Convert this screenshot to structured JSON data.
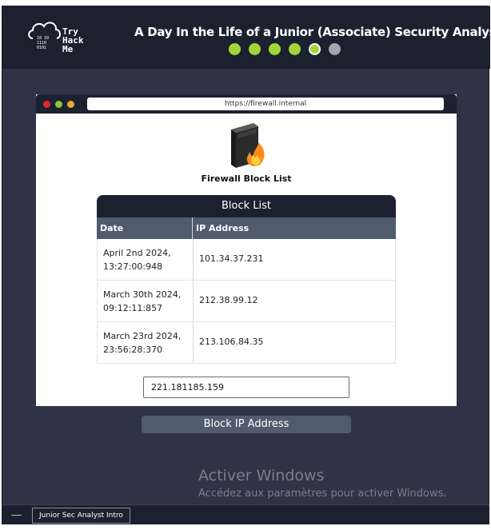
{
  "header": {
    "logo_text": "Try\nHack\nMe",
    "title": "A Day In the Life of a Junior (Associate) Security Analyst",
    "progress": {
      "completed": 4,
      "current": 5,
      "total": 6
    }
  },
  "browser": {
    "url": "https://firewall.internal"
  },
  "firewall": {
    "title": "Firewall Block List",
    "icon": "firewall-flame-icon"
  },
  "block_list": {
    "heading": "Block List",
    "columns": [
      "Date",
      "IP Address"
    ],
    "rows": [
      {
        "date": "April 2nd 2024,\n13:27:00:948",
        "ip": "101.34.37.231"
      },
      {
        "date": "March 30th 2024,\n09:12:11:857",
        "ip": "212.38.99.12"
      },
      {
        "date": "March 23rd 2024,\n23:56:28:370",
        "ip": "213.106.84.35"
      }
    ]
  },
  "ip_input": {
    "value": "221.181185.159"
  },
  "block_button": {
    "label": "Block IP Address"
  },
  "watermark": {
    "title": "Activer Windows",
    "subtitle": "Accédez aux paramètres pour activer Windows."
  },
  "taskbar": {
    "minimize_label": "—",
    "tab_label": "Junior Sec Analyst Intro"
  },
  "colors": {
    "accent_green": "#a3d539",
    "dark_navy": "#1c2130",
    "panel_slate": "#2e3446"
  }
}
